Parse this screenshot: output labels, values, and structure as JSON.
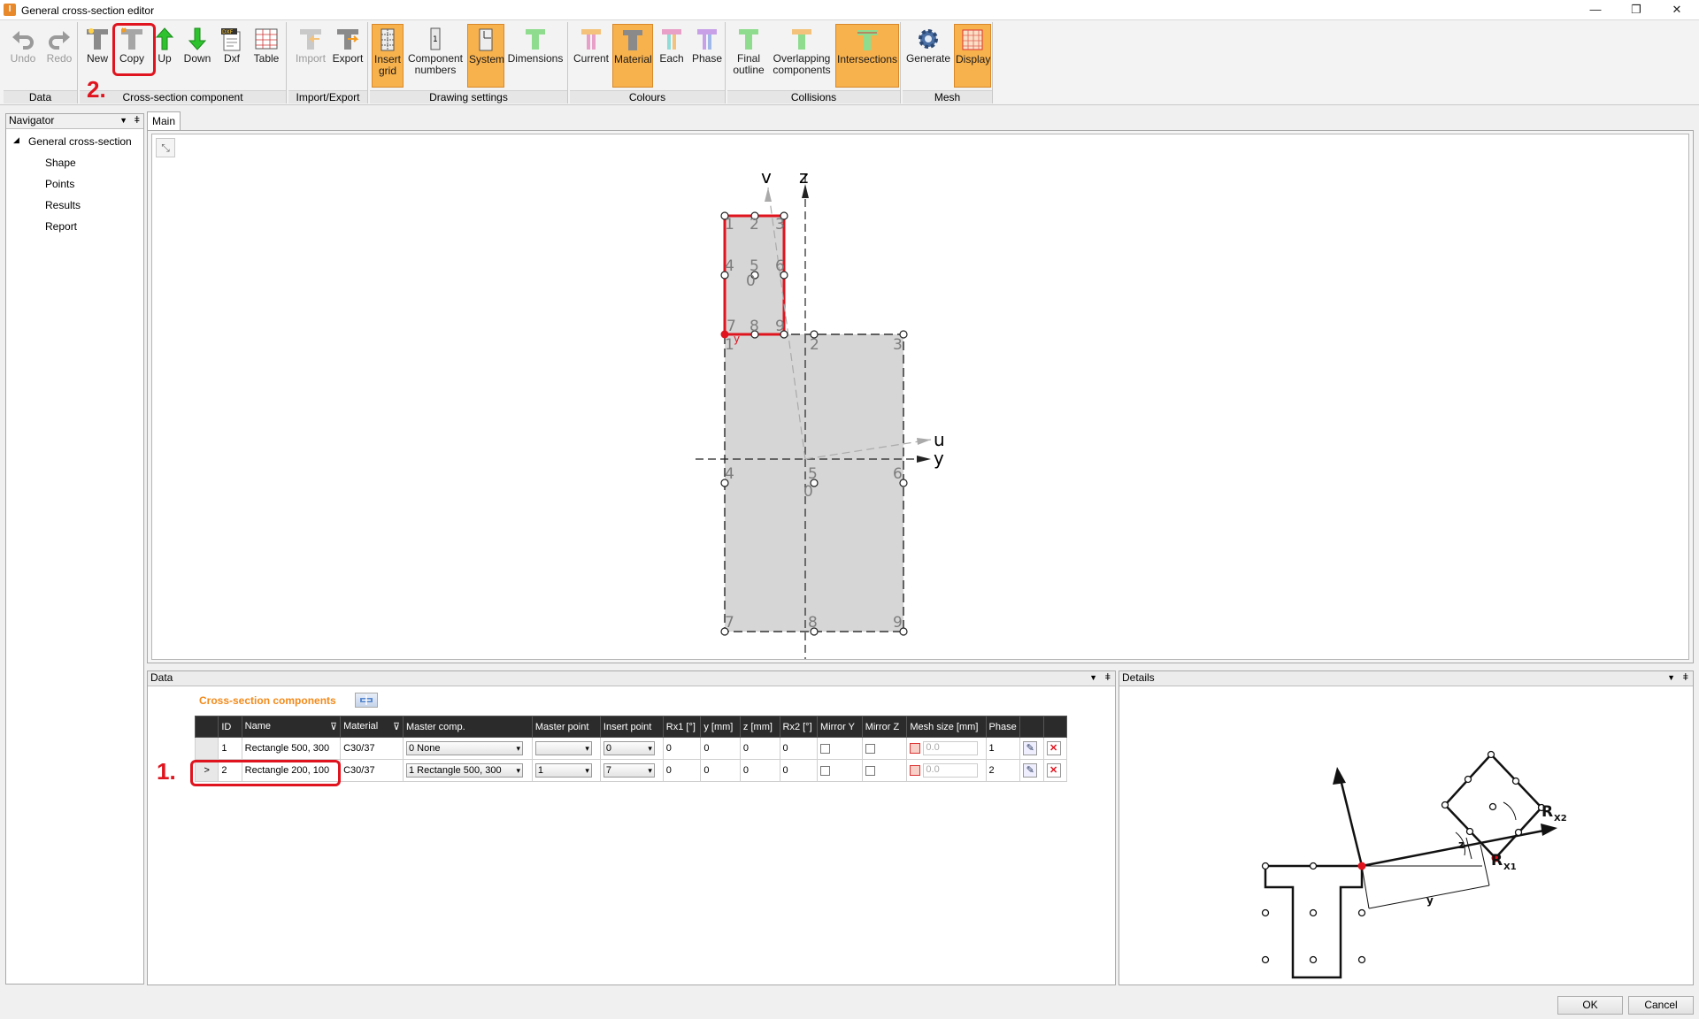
{
  "window": {
    "title": "General cross-section editor",
    "icon": "app-icon",
    "controls": [
      "—",
      "❐",
      "✕"
    ]
  },
  "ribbon": {
    "groups": [
      {
        "label": "Data",
        "buttons": [
          {
            "label": "Undo",
            "icon": "undo-icon",
            "enabled": false
          },
          {
            "label": "Redo",
            "icon": "redo-icon",
            "enabled": false
          }
        ]
      },
      {
        "label": "Cross-section component",
        "buttons": [
          {
            "label": "New",
            "icon": "new-component-icon"
          },
          {
            "label": "Copy",
            "icon": "copy-component-icon"
          },
          {
            "label": "Up",
            "icon": "arrow-up-icon"
          },
          {
            "label": "Down",
            "icon": "arrow-down-icon"
          },
          {
            "label": "Dxf",
            "icon": "dxf-icon"
          },
          {
            "label": "Table",
            "icon": "table-icon"
          }
        ]
      },
      {
        "label": "Import/Export",
        "buttons": [
          {
            "label": "Import",
            "icon": "import-icon",
            "enabled": false
          },
          {
            "label": "Export",
            "icon": "export-icon"
          }
        ]
      },
      {
        "label": "Drawing settings",
        "buttons": [
          {
            "label": "Insert grid",
            "icon": "insert-grid-icon",
            "active": true
          },
          {
            "label": "Component numbers",
            "icon": "component-numbers-icon"
          },
          {
            "label": "System",
            "icon": "system-icon",
            "active": true
          },
          {
            "label": "Dimensions",
            "icon": "dimensions-icon"
          }
        ]
      },
      {
        "label": "Colours",
        "buttons": [
          {
            "label": "Current",
            "icon": "colour-current-icon"
          },
          {
            "label": "Material",
            "icon": "colour-material-icon",
            "active": true
          },
          {
            "label": "Each",
            "icon": "colour-each-icon"
          },
          {
            "label": "Phase",
            "icon": "colour-phase-icon"
          }
        ]
      },
      {
        "label": "Collisions",
        "buttons": [
          {
            "label": "Final outline",
            "icon": "final-outline-icon"
          },
          {
            "label": "Overlapping components",
            "icon": "overlapping-icon"
          },
          {
            "label": "Intersections",
            "icon": "intersections-icon",
            "active": true
          }
        ]
      },
      {
        "label": "Mesh",
        "buttons": [
          {
            "label": "Generate",
            "icon": "gear-icon"
          },
          {
            "label": "Display",
            "icon": "mesh-display-icon",
            "active": true
          }
        ]
      }
    ],
    "step2": "2."
  },
  "navigator": {
    "title": "Navigator",
    "root": "General cross-section",
    "items": [
      "Shape",
      "Points",
      "Results",
      "Report"
    ]
  },
  "main": {
    "tab": "Main"
  },
  "drawing": {
    "axes": {
      "v": "v",
      "z": "z",
      "u": "u",
      "y": "y"
    },
    "small_rect_numbers": [
      "1",
      "2",
      "3",
      "4",
      "5",
      "6",
      "7",
      "8",
      "9",
      "0"
    ],
    "large_rect_numbers": [
      "1",
      "2",
      "3",
      "4",
      "5",
      "6",
      "7",
      "8",
      "9",
      "0"
    ],
    "insert_label": "y"
  },
  "data_panel": {
    "title": "Data",
    "section_title": "Cross-section components",
    "step1": "1.",
    "columns": [
      "ID",
      "Name",
      "Material",
      "Master comp.",
      "Master point",
      "Insert point",
      "Rx1 [°]",
      "y [mm]",
      "z [mm]",
      "Rx2 [°]",
      "Mirror Y",
      "Mirror Z",
      "Mesh size [mm]",
      "Phase",
      "",
      ""
    ],
    "rows": [
      {
        "selector": "",
        "id": "1",
        "name": "Rectangle 500, 300",
        "material": "C30/37",
        "master_comp": "0 None",
        "master_point": "",
        "insert_point": "0",
        "rx1": "0",
        "y": "0",
        "z": "0",
        "rx2": "0",
        "mesh": "0.0",
        "phase": "1"
      },
      {
        "selector": ">",
        "id": "2",
        "name": "Rectangle 200, 100",
        "material": "C30/37",
        "master_comp": "1 Rectangle 500, 300",
        "master_point": "1",
        "insert_point": "7",
        "rx1": "0",
        "y": "0",
        "z": "0",
        "rx2": "0",
        "mesh": "0.0",
        "phase": "2"
      }
    ]
  },
  "details_panel": {
    "title": "Details",
    "labels": {
      "rx2": "R",
      "rx2_sub": "X2",
      "rx1": "R",
      "rx1_sub": "X1",
      "z": "z",
      "y": "y"
    }
  },
  "footer": {
    "ok": "OK",
    "cancel": "Cancel"
  },
  "colors": {
    "accent": "#f7b14d",
    "highlight": "#e0141e",
    "selected_outline": "#e0141e",
    "section_fill": "#d6d6d6"
  }
}
